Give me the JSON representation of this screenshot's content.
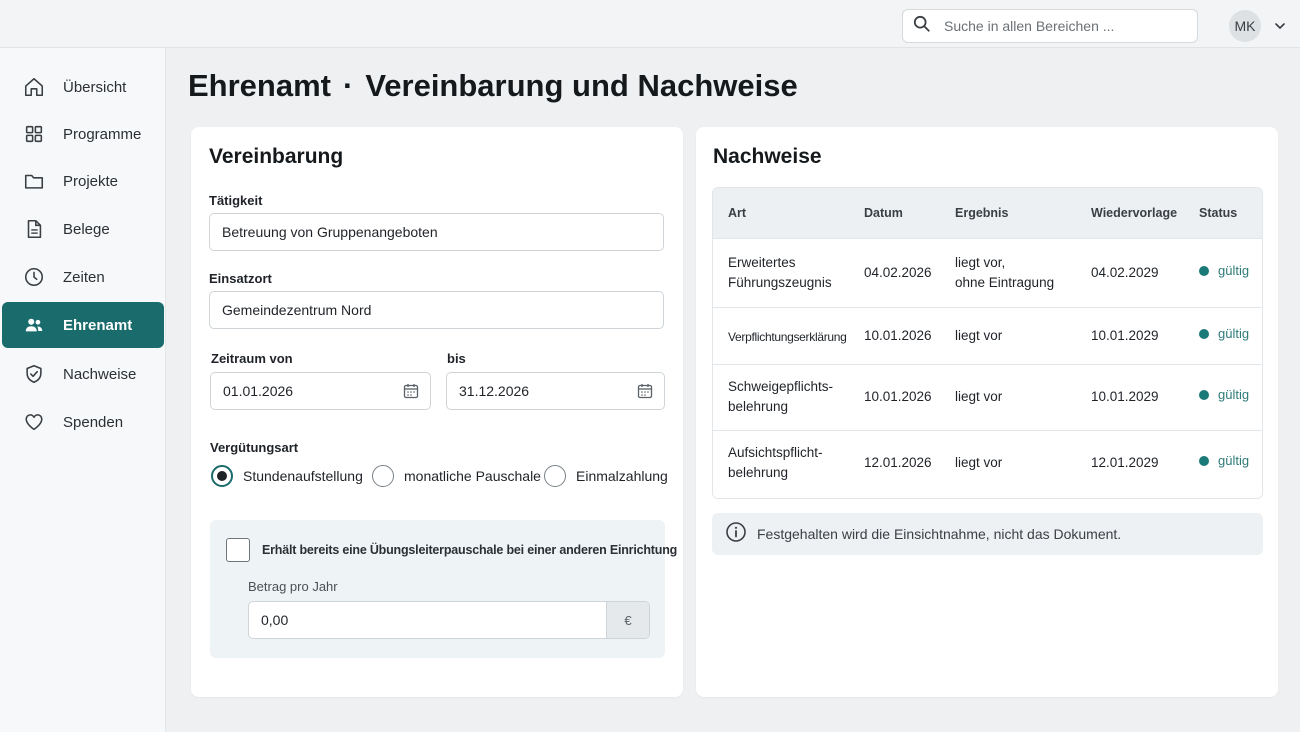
{
  "topbar": {
    "search_placeholder": "Suche in allen Bereichen ...",
    "user_initials": "MK"
  },
  "sidebar": {
    "items": [
      {
        "label": "Übersicht",
        "icon": "home-icon",
        "active": false
      },
      {
        "label": "Programme",
        "icon": "grid-icon",
        "active": false
      },
      {
        "label": "Projekte",
        "icon": "folder-icon",
        "active": false
      },
      {
        "label": "Belege",
        "icon": "document-icon",
        "active": false
      },
      {
        "label": "Zeiten",
        "icon": "clock-icon",
        "active": false
      },
      {
        "label": "Ehrenamt",
        "icon": "people-icon",
        "active": true
      },
      {
        "label": "Nachweise",
        "icon": "shield-check-icon",
        "active": false
      },
      {
        "label": "Spenden",
        "icon": "heart-icon",
        "active": false
      }
    ]
  },
  "page": {
    "title_part1": "Ehrenamt",
    "title_sep": "·",
    "title_part2": "Vereinbarung und Nachweise"
  },
  "vereinbarung": {
    "heading": "Vereinbarung",
    "taetigkeit_label": "Tätigkeit",
    "taetigkeit_value": "Betreuung von Gruppenangeboten",
    "einsatzort_label": "Einsatzort",
    "einsatzort_value": "Gemeindezentrum Nord",
    "zeitraum_von_label": "Zeitraum von",
    "zeitraum_von_value": "01.01.2026",
    "bis_label": "bis",
    "bis_value": "31.12.2026",
    "verguetungsart_label": "Vergütungsart",
    "verguetungsart_options": [
      "Stundenaufstellung",
      "monatliche Pauschale",
      "Einmalzahlung"
    ],
    "verguetungsart_selected": "Stundenaufstellung",
    "pauschale_checkbox_label": "Erhält bereits eine Übungsleiterpauschale bei einer anderen Einrichtung",
    "pauschale_checked": false,
    "betrag_label": "Betrag pro Jahr",
    "betrag_value": "0,00",
    "betrag_unit": "€"
  },
  "nachweise": {
    "heading": "Nachweise",
    "columns": [
      "Art",
      "Datum",
      "Ergebnis",
      "Wiedervorlage",
      "Status"
    ],
    "rows": [
      {
        "art": [
          "Erweitertes",
          "Führungszeugnis"
        ],
        "datum": "04.02.2026",
        "ergebnis": [
          "liegt vor,",
          "ohne Eintragung"
        ],
        "wiedervorlage": "04.02.2029",
        "status": "gültig"
      },
      {
        "art": [
          "Verpflichtungserklärung"
        ],
        "datum": "10.01.2026",
        "ergebnis": [
          "liegt vor"
        ],
        "wiedervorlage": "10.01.2029",
        "status": "gültig"
      },
      {
        "art": [
          "Schweigepflichts-",
          "belehrung"
        ],
        "datum": "10.01.2026",
        "ergebnis": [
          "liegt vor"
        ],
        "wiedervorlage": "10.01.2029",
        "status": "gültig"
      },
      {
        "art": [
          "Aufsichtspflicht-",
          "belehrung"
        ],
        "datum": "12.01.2026",
        "ergebnis": [
          "liegt vor"
        ],
        "wiedervorlage": "12.01.2029",
        "status": "gültig"
      }
    ],
    "status_color": "#1a7a78",
    "info_text": "Festgehalten wird die Einsichtnahme, nicht das Dokument."
  },
  "colors": {
    "accent": "#1a6b6b",
    "background": "#eef0f2"
  }
}
